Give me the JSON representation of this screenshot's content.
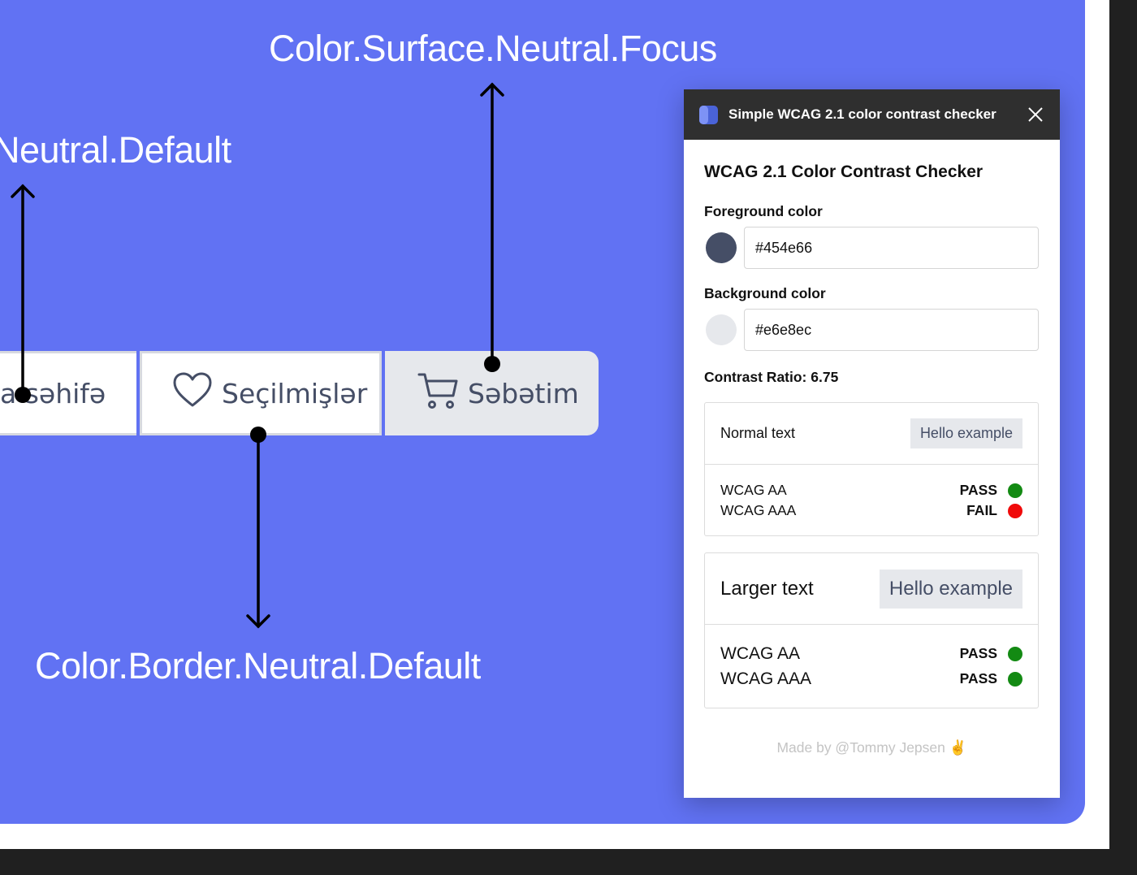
{
  "colors": {
    "canvas": "#6172f3",
    "foreground": "#454e66",
    "background": "#e6e8ec",
    "pass": "#138a13",
    "fail": "#f00a0a"
  },
  "annotations": {
    "focus": "Color.Surface.Neutral.Focus",
    "default": "Neutral.Default",
    "border": "Color.Border.Neutral.Default"
  },
  "nav": {
    "home_label": "a səhifə",
    "favorites_label": "Seçilmişlər",
    "cart_label": "Səbətim",
    "favorites_icon": "heart-icon",
    "cart_icon": "cart-icon"
  },
  "popup": {
    "title": "Simple WCAG 2.1 color contrast checker",
    "heading": "WCAG 2.1 Color Contrast Checker",
    "foreground_label": "Foreground color",
    "foreground_value": "#454e66",
    "background_label": "Background color",
    "background_value": "#e6e8ec",
    "contrast_ratio": "Contrast Ratio: 6.75",
    "normal": {
      "label": "Normal text",
      "example": "Hello example",
      "aa_label": "WCAG AA",
      "aa_result": "PASS",
      "aaa_label": "WCAG AAA",
      "aaa_result": "FAIL"
    },
    "large": {
      "label": "Larger text",
      "example": "Hello example",
      "aa_label": "WCAG AA",
      "aa_result": "PASS",
      "aaa_label": "WCAG AAA",
      "aaa_result": "PASS"
    },
    "footer": "Made by @Tommy Jepsen ✌️"
  }
}
